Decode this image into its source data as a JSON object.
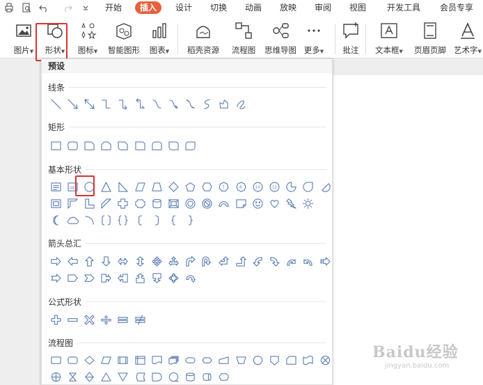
{
  "menubar": {
    "quick_access": [
      "print-icon",
      "print-preview-icon",
      "undo-icon",
      "redo-icon",
      "customize-icon"
    ],
    "tabs": [
      {
        "label": "开始",
        "active": false
      },
      {
        "label": "插入",
        "active": true
      },
      {
        "label": "设计",
        "active": false
      },
      {
        "label": "切换",
        "active": false
      },
      {
        "label": "动画",
        "active": false
      },
      {
        "label": "放映",
        "active": false
      },
      {
        "label": "审阅",
        "active": false
      },
      {
        "label": "视图",
        "active": false
      },
      {
        "label": "开发工具",
        "active": false
      },
      {
        "label": "会员专享",
        "active": false
      }
    ]
  },
  "ribbon": {
    "buttons": [
      {
        "label": "图片",
        "icon": "picture-icon",
        "dropdown": true
      },
      {
        "label": "形状",
        "icon": "shapes-icon",
        "dropdown": true
      },
      {
        "label": "图标",
        "icon": "icons-icon",
        "dropdown": true
      },
      {
        "label": "智能图形",
        "icon": "smart-graphic-icon",
        "dropdown": false
      },
      {
        "label": "图表",
        "icon": "chart-icon",
        "dropdown": true
      },
      {
        "label": "稻壳资源",
        "icon": "docer-resource-icon",
        "dropdown": false
      },
      {
        "label": "流程图",
        "icon": "flowchart-icon",
        "dropdown": false
      },
      {
        "label": "思维导图",
        "icon": "mindmap-icon",
        "dropdown": false
      },
      {
        "label": "更多",
        "icon": "more-icon",
        "dropdown": true
      },
      {
        "label": "批注",
        "icon": "comment-icon",
        "dropdown": false
      },
      {
        "label": "文本框",
        "icon": "textbox-icon",
        "dropdown": true
      },
      {
        "label": "页眉页脚",
        "icon": "header-footer-icon",
        "dropdown": false
      },
      {
        "label": "艺术字",
        "icon": "wordart-icon",
        "dropdown": true
      }
    ]
  },
  "panel": {
    "title": "预设",
    "sections": [
      {
        "label": "线条",
        "rows": [
          [
            "line",
            "arrow-line",
            "double-arrow-line",
            "elbow",
            "elbow-arrow",
            "elbow-double-arrow",
            "curve",
            "curve-arrow",
            "curve-double-arrow",
            "freeform",
            "freeform-shape",
            "scribble"
          ]
        ]
      },
      {
        "label": "矩形",
        "rows": [
          [
            "rect",
            "round-rect",
            "snip1-rect",
            "snip2-rect",
            "snip-round-rect",
            "round1-rect",
            "round2-rect",
            "round-diag-rect",
            "round-diag-rect2"
          ]
        ]
      },
      {
        "label": "基本形状",
        "rows": [
          [
            "textbox",
            "vtextbox",
            "ellipse",
            "triangle",
            "rtriangle",
            "parallelogram",
            "trapezoid",
            "diamond",
            "pentagon",
            "hexagon",
            "heptagon",
            "octagon",
            "decagon",
            "dodecagon",
            "pie",
            "teardrop",
            "chord"
          ],
          [
            "frame",
            "halfframe",
            "lshape",
            "diagstripe",
            "cross",
            "plaque",
            "can",
            "bevel",
            "donut",
            "noentry",
            "blockarc",
            "foldedcorner",
            "smiley",
            "heart",
            "lightning",
            "sun"
          ],
          [
            "moon",
            "cloud",
            "arc",
            "doublebracket",
            "doublebrace",
            "leftbracket",
            "rightbracket",
            "leftbrace",
            "rightbrace"
          ]
        ]
      },
      {
        "label": "箭头总汇",
        "rows": [
          [
            "arrow-right",
            "arrow-left",
            "arrow-up",
            "arrow-down",
            "arrow-leftright",
            "arrow-updown",
            "arrow-quad",
            "arrow-leftrightup",
            "arrow-bent",
            "arrow-uturn",
            "arrow-leftup",
            "arrow-bentup",
            "arrow-curvedright",
            "arrow-curvedleft",
            "arrow-curvedup",
            "arrow-curveddown",
            "arrow-striped"
          ],
          [
            "arrow-notched",
            "pentagon-arrow",
            "chevron",
            "callout-right",
            "callout-left",
            "callout-up",
            "callout-down",
            "callout-quad",
            "arrow-circular"
          ]
        ]
      },
      {
        "label": "公式形状",
        "rows": [
          [
            "plus",
            "minus",
            "multiply",
            "divide",
            "equal",
            "notequal"
          ]
        ]
      },
      {
        "label": "流程图",
        "rows": [
          [
            "fc-process",
            "fc-alternate",
            "fc-decision",
            "fc-data",
            "fc-predefined",
            "fc-internalstorage",
            "fc-document",
            "fc-multidoc",
            "fc-terminator",
            "fc-preparation",
            "fc-manualinput",
            "fc-manualop",
            "fc-connector",
            "fc-offpage",
            "fc-card",
            "fc-punchedtape",
            "fc-summing"
          ],
          [
            "fc-or",
            "fc-collate",
            "fc-sort",
            "fc-extract",
            "fc-merge",
            "fc-storeddata",
            "fc-delay",
            "fc-sequential",
            "fc-magneticdisk",
            "fc-directaccess",
            "fc-display"
          ]
        ]
      }
    ]
  },
  "watermark": {
    "text": "Baidu经验",
    "sub": "jingyan.baidu.com"
  },
  "colors": {
    "accent": "#e8603c",
    "shape_stroke": "#5e7fb5",
    "highlight": "#d83333"
  }
}
